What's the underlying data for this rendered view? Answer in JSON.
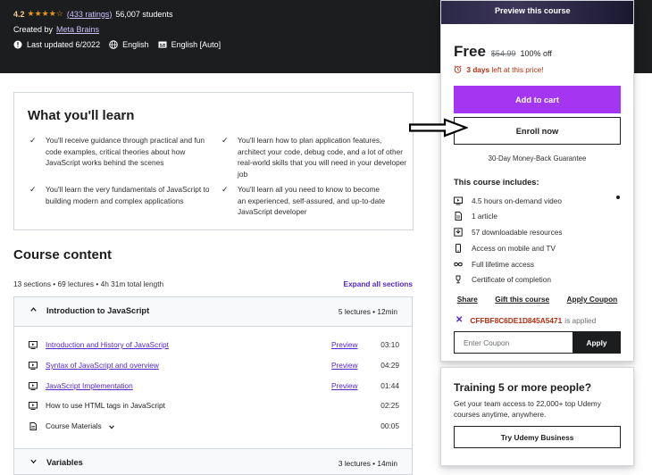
{
  "hero": {
    "rating_value": "4.2",
    "stars": "★★★★☆",
    "rating_count": "(433 ratings)",
    "students": "56,007 students",
    "created_by_label": "Created by",
    "author": "Meta Brains",
    "last_updated": "Last updated 6/2022",
    "language": "English",
    "captions": "English [Auto]"
  },
  "learn": {
    "title": "What you'll learn",
    "items": [
      "You'll receive guidance through practical and fun code examples, critical theories about how JavaScript works behind the scenes",
      "You'll learn how to plan application features, architect your code, debug code, and a lot of other real-world skills that you will need in your developer job",
      "You'll learn the very fundamentals of JavaScript to building modern and complex applications",
      "You'll learn all you need to know to become an experienced, self-assured, and up-to-date JavaScript developer"
    ]
  },
  "course_content": {
    "title": "Course content",
    "meta": "13 sections • 69 lectures • 4h 31m total length",
    "expand_label": "Expand all sections",
    "section1": {
      "title": "Introduction to JavaScript",
      "info": "5 lectures • 12min"
    },
    "lectures": [
      {
        "name": "Introduction and History of JavaScript",
        "preview": "Preview",
        "duration": "03:10",
        "icon": "video-icon"
      },
      {
        "name": "Syntax of JavaScript and overview",
        "preview": "Preview",
        "duration": "04:29",
        "icon": "video-icon"
      },
      {
        "name": "JavaScript Implementation",
        "preview": "Preview",
        "duration": "01:44",
        "icon": "video-icon"
      },
      {
        "name": "How to use HTML tags in JavaScript",
        "preview": "",
        "duration": "02:25",
        "icon": "video-icon"
      },
      {
        "name": "Course Materials",
        "preview": "",
        "duration": "00:05",
        "icon": "file-icon"
      }
    ],
    "section2": {
      "title": "Variables",
      "info": "3 lectures • 14min"
    }
  },
  "sidebar": {
    "preview_label": "Preview this course",
    "price": "Free",
    "original_price": "$54.99",
    "discount": "100% off",
    "timer_bold": "3 days",
    "timer_rest": "left at this price!",
    "add_to_cart": "Add to cart",
    "enroll_now": "Enroll now",
    "guarantee": "30-Day Money-Back Guarantee",
    "includes_title": "This course includes:",
    "includes": [
      {
        "icon": "video-icon",
        "text": "4.5 hours on-demand video"
      },
      {
        "icon": "article-icon",
        "text": "1 article"
      },
      {
        "icon": "download-icon",
        "text": "57 downloadable resources"
      },
      {
        "icon": "mobile-icon",
        "text": "Access on mobile and TV"
      },
      {
        "icon": "infinity-icon",
        "text": "Full lifetime access"
      },
      {
        "icon": "trophy-icon",
        "text": "Certificate of completion"
      }
    ],
    "share": "Share",
    "gift": "Gift this course",
    "apply_coupon": "Apply Coupon",
    "coupon_code": "CFFBF8C6DE1D845A5471",
    "coupon_status": "is applied",
    "coupon_placeholder": "Enter Coupon",
    "apply_button": "Apply"
  },
  "business": {
    "title": "Training 5 or more people?",
    "text": "Get your team access to 22,000+ top Udemy courses anytime, anywhere.",
    "button": "Try Udemy Business"
  },
  "colors": {
    "accent": "#a435f0",
    "link": "#5624d0",
    "alert": "#b32d0f",
    "dark": "#1c1d1f"
  }
}
